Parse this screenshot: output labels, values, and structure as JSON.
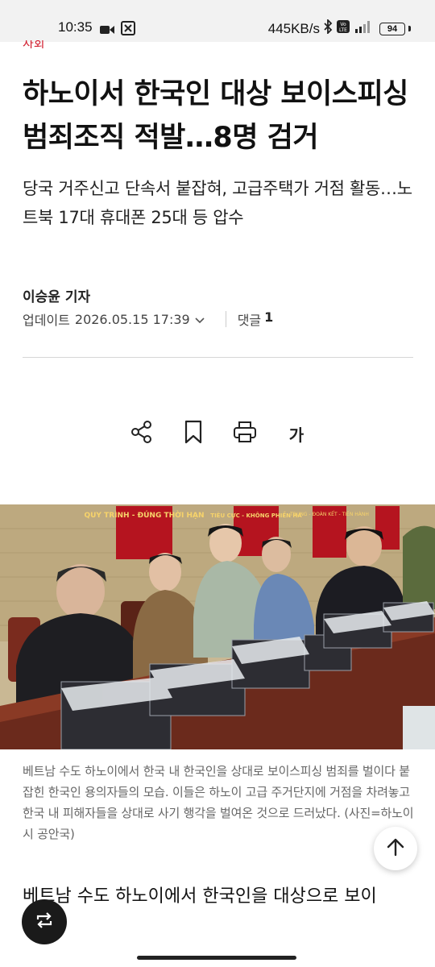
{
  "status_bar": {
    "time": "10:35",
    "network_speed": "445KB/s",
    "battery": "94"
  },
  "article": {
    "section_tag": "사회",
    "headline": "하노이서 한국인 대상 보이스피싱 범죄조직 적발…8명 검거",
    "subheadline": "당국 거주신고 단속서 붙잡혀, 고급주택가 거점 활동…노트북 17대 휴대폰 25대 등 압수",
    "byline": "이승윤 기자",
    "update_label": "업데이트",
    "update_datetime": "2026.05.15 17:39",
    "comments_label": "댓글",
    "comments_count": "1",
    "photo_signs": [
      "QUY TRÌNH - ĐÚNG THỜI HẠN",
      "TIÊU CỰC - KHÔNG PHIỀN HÀ",
      "TRUNG - ĐOÀN KẾT - TIẾN HÀNH"
    ],
    "caption": "베트남 수도 하노이에서 한국 내 한국인을 상대로 보이스피싱 범죄를 벌이다 붙잡힌 한국인 용의자들의 모습. 이들은 하노이 고급 주거단지에 거점을 차려놓고 한국 내 피해자들을 상대로 사기 행각을 벌여온 것으로 드러났다. (사진=하노이시 공안국)",
    "body_first_line": "베트남 수도 하노이에서 한국인을 대상으로 보이"
  },
  "toolbar": {
    "share_icon": "share-icon",
    "bookmark_icon": "bookmark-icon",
    "print_icon": "print-icon",
    "font_size_label": "가"
  },
  "colors": {
    "accent_red": "#d21f2f",
    "text_primary": "#111111",
    "caption_gray": "#666666",
    "divider": "#d6d6d6",
    "fab_bg": "#1a1a1a"
  }
}
